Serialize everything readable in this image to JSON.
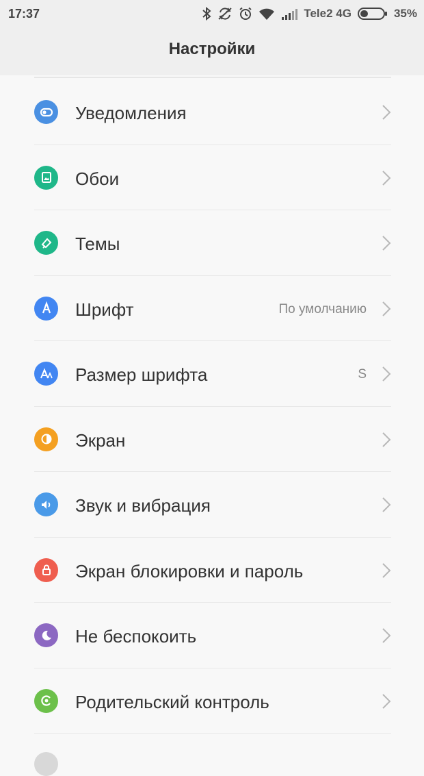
{
  "status_bar": {
    "time": "17:37",
    "carrier": "Tele2 4G",
    "battery_percent": "35%",
    "icons": [
      "bluetooth-icon",
      "sync-icon",
      "alarm-icon",
      "wifi-icon",
      "signal-icon",
      "battery-icon"
    ],
    "battery_level": 0.35
  },
  "header": {
    "title": "Настройки"
  },
  "settings": {
    "items": [
      {
        "label": "Уведомления",
        "value": "",
        "icon": "notifications-icon",
        "color": "#4a90e2"
      },
      {
        "label": "Обои",
        "value": "",
        "icon": "wallpaper-icon",
        "color": "#1fb789"
      },
      {
        "label": "Темы",
        "value": "",
        "icon": "themes-icon",
        "color": "#1fb789"
      },
      {
        "label": "Шрифт",
        "value": "По умолчанию",
        "icon": "font-icon",
        "color": "#4286f2"
      },
      {
        "label": "Размер шрифта",
        "value": "S",
        "icon": "font-size-icon",
        "color": "#4286f2"
      },
      {
        "label": "Экран",
        "value": "",
        "icon": "display-icon",
        "color": "#f4a021"
      },
      {
        "label": "Звук и вибрация",
        "value": "",
        "icon": "sound-icon",
        "color": "#4a9ae8"
      },
      {
        "label": "Экран блокировки и пароль",
        "value": "",
        "icon": "lock-icon",
        "color": "#ef5e4f"
      },
      {
        "label": "Не беспокоить",
        "value": "",
        "icon": "do-not-disturb-icon",
        "color": "#8c68c2"
      },
      {
        "label": "Родительский контроль",
        "value": "",
        "icon": "parental-control-icon",
        "color": "#6cc04a"
      }
    ]
  }
}
